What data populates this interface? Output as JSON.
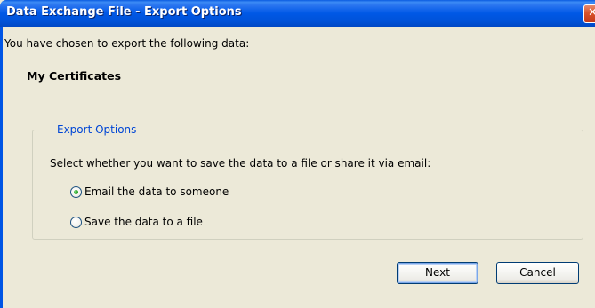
{
  "window": {
    "title": "Data Exchange File - Export Options",
    "close_glyph": "✕"
  },
  "intro": {
    "text": "You have chosen to export the following data:",
    "data_item": "My Certificates"
  },
  "export_options": {
    "legend": "Export Options",
    "description": "Select whether you want to save the data to a file or share it via email:",
    "options": [
      {
        "label": "Email the data to someone",
        "selected": true
      },
      {
        "label": "Save the data to a file",
        "selected": false
      }
    ]
  },
  "buttons": {
    "next_label": "Next",
    "cancel_label": "Cancel"
  },
  "colors": {
    "titlebar": "#0058E6",
    "dialog_bg": "#ECE9D8",
    "legend_text": "#0046D5",
    "close_button": "#D9542B"
  }
}
